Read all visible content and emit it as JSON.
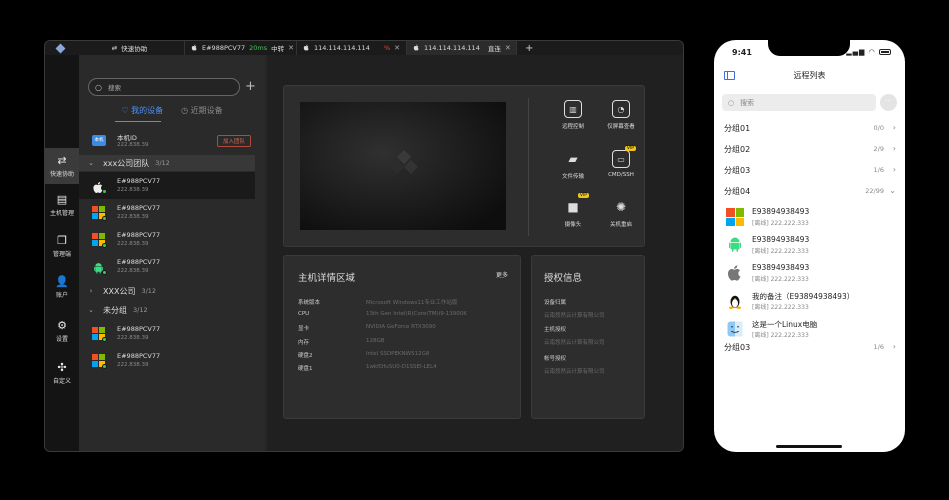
{
  "tabs": [
    {
      "label": "快速协助",
      "icon": "swap-icon"
    },
    {
      "label": "E#988PCV77",
      "status": "20ms",
      "status2": "中转",
      "icon": "apple-icon"
    },
    {
      "label": "114.114.114.114",
      "status": "%",
      "icon": "apple-icon"
    },
    {
      "label": "114.114.114.114",
      "status": "直连",
      "icon": "apple-icon",
      "active": true
    }
  ],
  "rail": [
    {
      "label": "快速协助",
      "icon": "swap-icon",
      "active": true
    },
    {
      "label": "主机管理",
      "icon": "host-icon"
    },
    {
      "label": "管理端",
      "icon": "window-stack-icon"
    },
    {
      "label": "账户",
      "icon": "user-icon"
    },
    {
      "label": "设置",
      "icon": "gear-icon"
    },
    {
      "label": "自定义",
      "icon": "puzzle-icon"
    }
  ],
  "devices": {
    "search_placeholder": "搜索",
    "seg_mine": "我的设备",
    "seg_recent": "近期设备",
    "local": {
      "name": "本机ID",
      "sub": "222.838.39",
      "icon_text": "本机",
      "join_label": "加入团队"
    },
    "group1": {
      "name": "xxx公司团队",
      "count": "3/12"
    },
    "items1": [
      {
        "name": "E#988PCV77",
        "sub": "222.838.39",
        "os": "apple"
      },
      {
        "name": "E#988PCV77",
        "sub": "222.838.39",
        "os": "windows"
      },
      {
        "name": "E#988PCV77",
        "sub": "222.838.39",
        "os": "windows"
      },
      {
        "name": "E#988PCV77",
        "sub": "222.838.39",
        "os": "android"
      }
    ],
    "group2": {
      "name": "XXX公司",
      "count": "3/12"
    },
    "group3": {
      "name": "未分组",
      "count": "3/12"
    },
    "items3": [
      {
        "name": "E#988PCV77",
        "sub": "222.838.39",
        "os": "windows"
      },
      {
        "name": "E#988PCV77",
        "sub": "222.838.39",
        "os": "windows"
      }
    ]
  },
  "actions": [
    {
      "label": "远程控制",
      "icon": "remote-control-icon"
    },
    {
      "label": "仅屏幕查看",
      "icon": "screen-view-icon"
    },
    {
      "label": "文件传输",
      "icon": "folder-icon"
    },
    {
      "label": "CMD/SSH",
      "icon": "terminal-icon",
      "vip": "VIP"
    },
    {
      "label": "摄像头",
      "icon": "camera-icon",
      "vip": "VIP"
    },
    {
      "label": "关机重启",
      "icon": "power-icon"
    }
  ],
  "info": {
    "title": "主机详情区域",
    "more": "更多",
    "rows": [
      {
        "k": "系统版本",
        "v": "Microsoft Windows11专业工作站版"
      },
      {
        "k": "CPU",
        "v": "13th Gen Intel(R)Core(TM)i9-13900K"
      },
      {
        "k": "显卡",
        "v": "NVIDIA GeForce RTX3090"
      },
      {
        "k": "内存",
        "v": "128GB"
      },
      {
        "k": "硬盘2",
        "v": "Intel SSDPEKNW512G8"
      },
      {
        "k": "硬盘1",
        "v": "1wkfDfuSU0-D1SSEI-LEL4"
      }
    ]
  },
  "auth": {
    "title": "授权信息",
    "rows": [
      {
        "k": "设备归属",
        "v": "云南悠然云计算有限公司"
      },
      {
        "k": "主机授权",
        "v": "云南悠然云计算有限公司"
      },
      {
        "k": "帐号授权",
        "v": "云南悠然云计算有限公司"
      }
    ]
  },
  "phone": {
    "time": "9:41",
    "title": "远程列表",
    "search_placeholder": "搜索",
    "groups_top": [
      {
        "name": "分组01",
        "count": "0/0"
      },
      {
        "name": "分组02",
        "count": "2/9"
      },
      {
        "name": "分组03",
        "count": "1/6"
      },
      {
        "name": "分组04",
        "count": "22/99"
      }
    ],
    "devices": [
      {
        "name": "E93894938493",
        "sub": "[离线] 222.222.333",
        "os": "windows"
      },
      {
        "name": "E93894938493",
        "sub": "[离线] 222.222.333",
        "os": "android"
      },
      {
        "name": "E93894938493",
        "sub": "[离线] 222.222.333",
        "os": "apple"
      },
      {
        "name": "我的备注（E93894938493）",
        "sub": "[离线] 222.222.333",
        "os": "linux"
      },
      {
        "name": "这是一个Linux电脑",
        "sub": "[离线] 222.222.333",
        "os": "mac-finder"
      }
    ],
    "group_bottom": {
      "name": "分组03",
      "count": "1/6"
    }
  },
  "colors": {
    "accent": "#4f8ff7",
    "online": "#46c35b",
    "vip": "#f0c419",
    "join": "#d86a57"
  }
}
